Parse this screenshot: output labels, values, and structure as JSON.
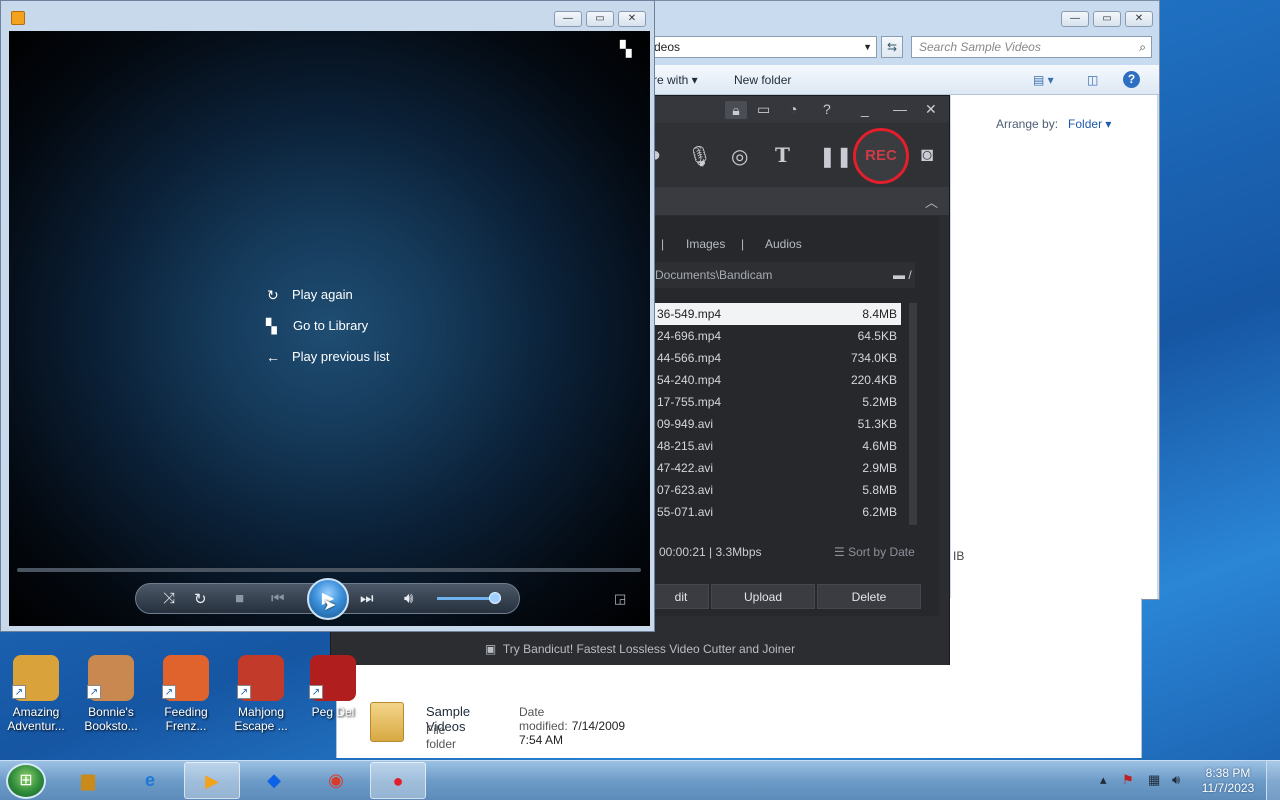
{
  "explorer": {
    "address_partial": "deos",
    "search_placeholder": "Search Sample Videos",
    "share_with_partial": "re with",
    "new_folder": "New folder",
    "arrange_by_label": "Arrange by:",
    "arrange_by_value": "Folder",
    "partial_size_text": "IB",
    "folder": {
      "name": "Sample Videos",
      "date_label": "Date modified:",
      "date_value": "7/14/2009 7:54 AM",
      "type": "File folder"
    }
  },
  "bandicam": {
    "tabs": [
      "Images",
      "Audios"
    ],
    "path_partial": "Documents\\Bandicam",
    "path_icon_suffix": "/",
    "rec_label": "REC",
    "files": [
      {
        "name": "36-549.mp4",
        "size": "8.4MB",
        "selected": true
      },
      {
        "name": "24-696.mp4",
        "size": "64.5KB"
      },
      {
        "name": "44-566.mp4",
        "size": "734.0KB"
      },
      {
        "name": "54-240.mp4",
        "size": "220.4KB"
      },
      {
        "name": "17-755.mp4",
        "size": "5.2MB"
      },
      {
        "name": "09-949.avi",
        "size": "51.3KB"
      },
      {
        "name": "48-215.avi",
        "size": "4.6MB"
      },
      {
        "name": "47-422.avi",
        "size": "2.9MB"
      },
      {
        "name": "07-623.avi",
        "size": "5.8MB"
      },
      {
        "name": "55-071.avi",
        "size": "6.2MB"
      }
    ],
    "info": "00:00:21 | 3.3Mbps",
    "sort_label": "Sort by Date",
    "buttons": {
      "edit_partial": "dit",
      "upload": "Upload",
      "delete": "Delete"
    },
    "promo": "Try Bandicut! Fastest Lossless Video Cutter and Joiner"
  },
  "player": {
    "menu": {
      "play_again": "Play again",
      "go_to_library": "Go to Library",
      "play_previous": "Play previous list"
    },
    "volume_level": 0.9
  },
  "desktop_icons": [
    {
      "label": "Amazing Adventur...",
      "color": "#d9a23a"
    },
    {
      "label": "Bonnie's Booksto...",
      "color": "#c9884f"
    },
    {
      "label": "Feeding Frenz...",
      "color": "#e0632e"
    },
    {
      "label": "Mahjong Escape ...",
      "color": "#c23a2a"
    },
    {
      "label": "Peg Del",
      "color": "#b01e1e"
    }
  ],
  "taskbar": {
    "time": "8:38 PM",
    "date": "11/7/2023"
  }
}
